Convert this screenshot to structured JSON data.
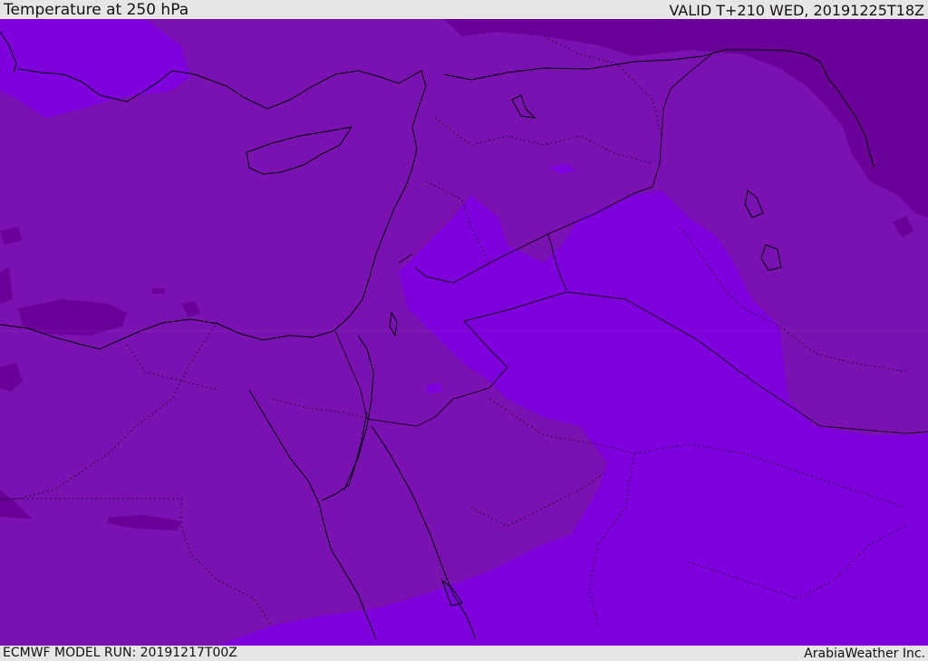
{
  "header": {
    "title": "Temperature at 250 hPa",
    "valid": "VALID T+210 WED, 20191225T18Z"
  },
  "footer": {
    "model_run": "ECMWF MODEL RUN: 20191217T00Z",
    "credit": "ArabiaWeather Inc."
  },
  "map": {
    "colors": {
      "warm_band": "#7a12b2",
      "cold_band": "#7e00dc",
      "coldest_band": "#6a0098",
      "coast_line": "#000000",
      "border_line": "#2a0a3a"
    }
  }
}
